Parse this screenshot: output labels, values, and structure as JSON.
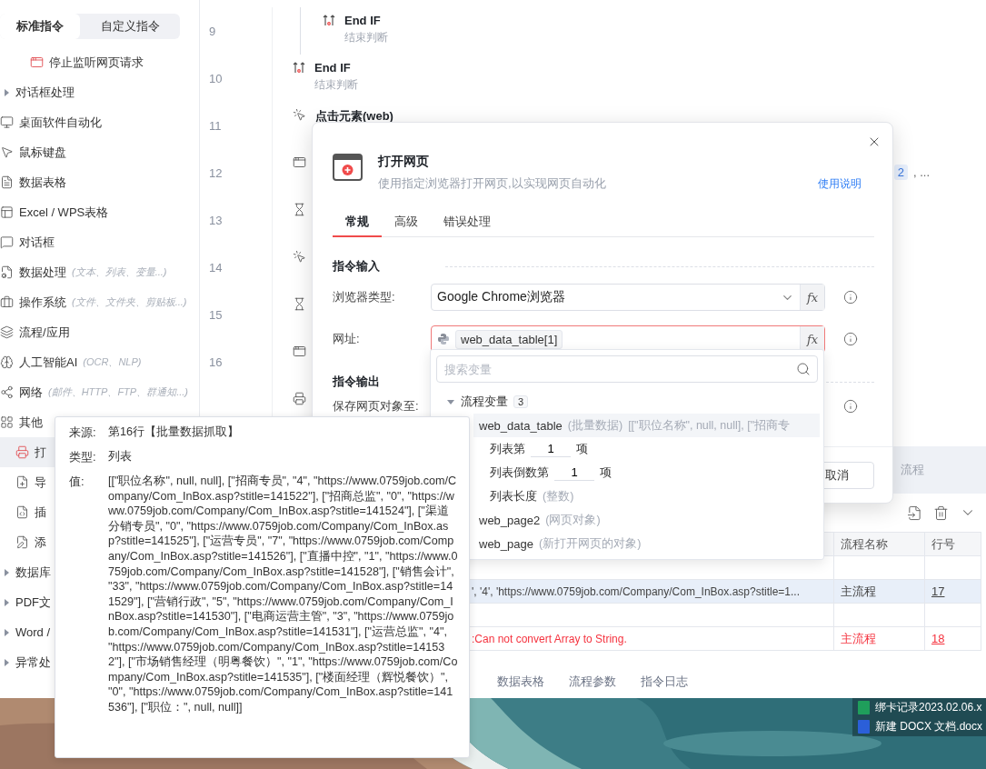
{
  "sidebar": {
    "tabs": [
      {
        "label": "标准指令",
        "selected": true
      },
      {
        "label": "自定义指令",
        "selected": false
      }
    ],
    "items": [
      {
        "label": "停止监听网页请求",
        "kind": "child",
        "selected": false
      },
      {
        "label": "对话框处理",
        "kind": "folder",
        "expanded": false,
        "selected": false
      },
      {
        "label": "桌面软件自动化",
        "kind": "category",
        "selected": false
      },
      {
        "label": "鼠标键盘",
        "kind": "category",
        "selected": false
      },
      {
        "label": "数据表格",
        "kind": "category",
        "selected": false
      },
      {
        "label": "Excel / WPS表格",
        "kind": "category",
        "selected": false
      },
      {
        "label": "对话框",
        "kind": "category",
        "selected": false
      },
      {
        "label": "数据处理",
        "hint": "(文本、列表、变量...)",
        "kind": "category",
        "selected": false
      },
      {
        "label": "操作系统",
        "hint": "(文件、文件夹、剪贴板...)",
        "kind": "category",
        "selected": false
      },
      {
        "label": "流程/应用",
        "kind": "category",
        "selected": false
      },
      {
        "label": "人工智能AI",
        "hint": "(OCR、NLP)",
        "kind": "category",
        "selected": false
      },
      {
        "label": "网络",
        "hint": "(邮件、HTTP、FTP、群通知...)",
        "kind": "category",
        "selected": false
      },
      {
        "label": "其他",
        "kind": "category",
        "selected": false,
        "children": [
          {
            "label": "打",
            "selected": true
          },
          {
            "label": "导",
            "selected": false
          },
          {
            "label": "插",
            "selected": false
          },
          {
            "label": "添",
            "selected": false
          }
        ]
      },
      {
        "label": "数据库",
        "kind": "folder",
        "expanded": false,
        "selected": false
      },
      {
        "label": "PDF文",
        "kind": "folder",
        "expanded": false,
        "selected": false
      },
      {
        "label": "Word /",
        "kind": "folder",
        "expanded": false,
        "selected": false
      },
      {
        "label": "异常处",
        "kind": "folder",
        "expanded": false,
        "selected": false
      }
    ]
  },
  "flow": {
    "steps": [
      {
        "line": "9",
        "kind": "inner",
        "title": "End IF",
        "subtitle": "结束判断"
      },
      {
        "line": "10",
        "kind": "step",
        "title": "End IF",
        "subtitle": "结束判断"
      },
      {
        "line": "11",
        "kind": "step",
        "title": "点击元素(web)"
      },
      {
        "line": "12",
        "kind": "step",
        "tail_badge": "2",
        "tail": ", ..."
      },
      {
        "line": "13",
        "kind": "step"
      },
      {
        "line": "14",
        "kind": "step"
      },
      {
        "line": "15",
        "kind": "step"
      },
      {
        "line": "16",
        "kind": "step"
      },
      {
        "kind": "step"
      }
    ],
    "band_label": "流程"
  },
  "log": {
    "columns": [
      "流程名称",
      "行号"
    ],
    "rows": [
      {
        "kind": "blank",
        "selected": false
      },
      {
        "kind": "info",
        "selected": true,
        "message": "', '4', 'https://www.0759job.com/Company/Com_InBox.asp?stitle=1...",
        "flow": "主流程",
        "line": "17"
      },
      {
        "kind": "blank",
        "selected": false
      },
      {
        "kind": "error",
        "selected": false,
        "message": ":Can not convert Array to String.",
        "flow": "主流程",
        "line": "18"
      }
    ],
    "tabs": [
      "数据表格",
      "流程参数",
      "指令日志"
    ]
  },
  "dialog": {
    "title": "打开网页",
    "subtitle": "使用指定浏览器打开网页,以实现网页自动化",
    "help_link": "使用说明",
    "tabs": [
      {
        "label": "常规",
        "selected": true
      },
      {
        "label": "高级",
        "selected": false
      },
      {
        "label": "错误处理",
        "selected": false
      }
    ],
    "input_section": "指令输入",
    "browser": {
      "label": "浏览器类型:",
      "value": "Google Chrome浏览器",
      "fx": "fx"
    },
    "url": {
      "label": "网址:",
      "chip": "web_data_table[1]",
      "error": true,
      "fx": "fx"
    },
    "output_section": "指令输出",
    "save_label": "保存网页对象至:",
    "cancel": "取消"
  },
  "variable_menu": {
    "search_placeholder": "搜索变量",
    "group": {
      "label": "流程变量",
      "count": "3",
      "expanded": true,
      "items": [
        {
          "name": "web_data_table",
          "type": "(批量数据)",
          "preview": "[[\"职位名称\", null, null], [\"招商专",
          "selected": true,
          "children": [
            {
              "kind": "index",
              "label": "列表第",
              "value": "1",
              "suffix": "项"
            },
            {
              "kind": "index",
              "label": "列表倒数第",
              "value": "1",
              "suffix": "项"
            },
            {
              "kind": "plain",
              "label": "列表长度",
              "hint": "(整数)"
            }
          ]
        },
        {
          "name": "web_page2",
          "type": "(网页对象)",
          "selected": false
        },
        {
          "name": "web_page",
          "type": "(新打开网页的对象)",
          "selected": false
        }
      ]
    }
  },
  "tooltip": {
    "rows": [
      {
        "label": "来源:",
        "value": "第16行【批量数据抓取】"
      },
      {
        "label": "类型:",
        "value": "列表"
      },
      {
        "label": "值:",
        "value": "[[\"职位名称\", null, null], [\"招商专员\", \"4\", \"https://www.0759job.com/Company/Com_InBox.asp?stitle=141522\"], [\"招商总监\", \"0\", \"https://www.0759job.com/Company/Com_InBox.asp?stitle=141524\"], [\"渠道分销专员\", \"0\", \"https://www.0759job.com/Company/Com_InBox.asp?stitle=141525\"], [\"运营专员\", \"7\", \"https://www.0759job.com/Company/Com_InBox.asp?stitle=141526\"], [\"直播中控\", \"1\", \"https://www.0759job.com/Company/Com_InBox.asp?stitle=141528\"], [\"销售会计\", \"33\", \"https://www.0759job.com/Company/Com_InBox.asp?stitle=141529\"], [\"营销行政\", \"5\", \"https://www.0759job.com/Company/Com_InBox.asp?stitle=141530\"], [\"电商运营主管\", \"3\", \"https://www.0759job.com/Company/Com_InBox.asp?stitle=141531\"], [\"运营总监\", \"4\", \"https://www.0759job.com/Company/Com_InBox.asp?stitle=141532\"], [\"市场销售经理（明粤餐饮）\", \"1\", \"https://www.0759job.com/Company/Com_InBox.asp?stitle=141535\"], [\"楼面经理（辉悦餐饮）\", \"0\", \"https://www.0759job.com/Company/Com_InBox.asp?stitle=141536\"], [\"职位：\", null, null]]"
      }
    ]
  },
  "desktop": {
    "files": [
      {
        "name": "绑卡记录2023.02.06.x",
        "kind": "sheet"
      },
      {
        "name": "新建 DOCX 文档.docx",
        "kind": "doc"
      }
    ]
  }
}
